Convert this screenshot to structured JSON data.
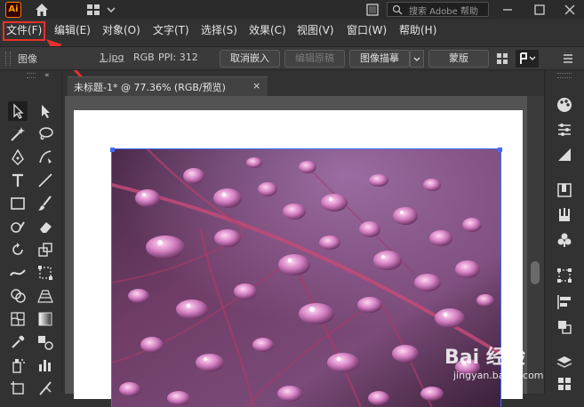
{
  "app": {
    "logo": "Ai",
    "search_placeholder": "搜索 Adobe 帮助"
  },
  "menu": {
    "items": [
      {
        "label": "文件(F)"
      },
      {
        "label": "编辑(E)"
      },
      {
        "label": "对象(O)"
      },
      {
        "label": "文字(T)"
      },
      {
        "label": "选择(S)"
      },
      {
        "label": "效果(C)"
      },
      {
        "label": "视图(V)"
      },
      {
        "label": "窗口(W)"
      },
      {
        "label": "帮助(H)"
      }
    ]
  },
  "control_bar": {
    "object_type": "图像",
    "file_name": "1.jpg",
    "color_mode": "RGB",
    "ppi": "PPI: 312",
    "unembed_button": "取消嵌入",
    "edit_original_button": "编辑原稿",
    "image_trace_button": "图像描摹",
    "mask_button": "蒙版"
  },
  "document": {
    "tab_title": "未标题-1* @ 77.36% (RGB/预览)",
    "close_glyph": "×"
  },
  "watermark": {
    "brand": "Bai 经验",
    "url": "jingyan.baidu.com"
  },
  "colors": {
    "accent_highlight": "#e8312b",
    "selection": "#3f6bff",
    "ai_brand": "#ff9a00"
  }
}
